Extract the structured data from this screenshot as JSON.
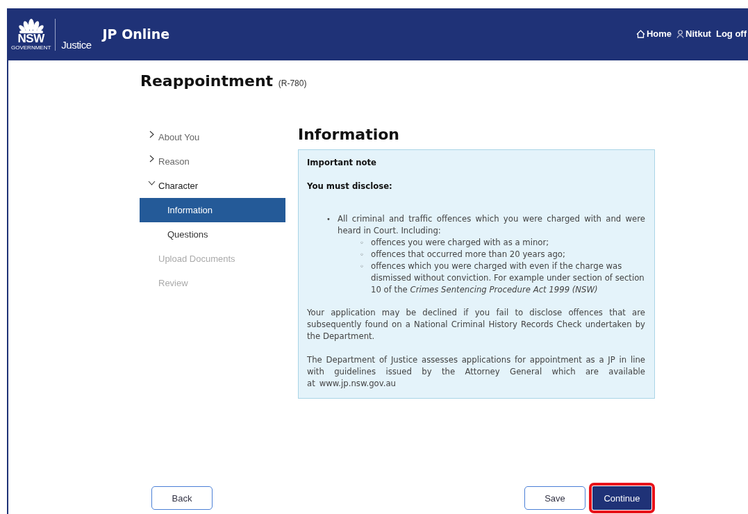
{
  "header": {
    "logo": {
      "mark": "NSW",
      "sub": "GOVERNMENT",
      "agency": "Justice"
    },
    "app_title": "JP Online",
    "links": [
      {
        "kind": "home",
        "label": "Home"
      },
      {
        "kind": "user",
        "label": "Nitkut"
      },
      {
        "kind": "plain",
        "label": "Log off"
      }
    ]
  },
  "page": {
    "title": "Reappointment",
    "code": "(R-780)"
  },
  "nav": [
    {
      "label": "About You",
      "kind": "section",
      "expanded": false,
      "disabled": false,
      "selected": false
    },
    {
      "label": "Reason",
      "kind": "section",
      "expanded": false,
      "disabled": false,
      "selected": false
    },
    {
      "label": "Character",
      "kind": "section",
      "expanded": true,
      "disabled": false,
      "selected": false,
      "children": [
        {
          "label": "Information",
          "disabled": false,
          "selected": true
        },
        {
          "label": "Questions",
          "disabled": false,
          "selected": false
        }
      ]
    },
    {
      "label": "Upload Documents",
      "kind": "plain",
      "disabled": true,
      "selected": false
    },
    {
      "label": "Review",
      "kind": "plain",
      "disabled": true,
      "selected": false
    }
  ],
  "content": {
    "heading": "Information",
    "note": {
      "title": "Important note",
      "lead": "You must disclose:",
      "bullets": [
        {
          "marker": "•",
          "text": "All criminal and traffic offences which you were charged with and were heard in Court. Including:",
          "children": [
            {
              "marker": "◦",
              "text": "offences you were charged with as a minor;"
            },
            {
              "marker": "◦",
              "text": "offences that occurred more than 20 years ago;"
            },
            {
              "marker": "◦",
              "text": "offences which you were charged with even if the charge was dismissed without conviction. For example under section of section 10 of the *Crimes Sentencing Procedure Act 1999 (NSW)*"
            }
          ]
        }
      ],
      "paragraphs": [
        {
          "text": "Your application may be declined if you fail to disclose offences that are subsequently found on a National Criminal History Records Check undertaken by the Department."
        },
        {
          "text": "The Department of Justice assesses applications for appointment as a JP in line with guidelines issued by the Attorney General which are available at",
          "link": "www.jp.nsw.gov.au"
        }
      ]
    }
  },
  "buttons": [
    {
      "label": "Back",
      "kind": "secondary",
      "highlighted": false
    },
    {
      "label": "Save",
      "kind": "secondary",
      "highlighted": false
    },
    {
      "label": "Continue",
      "kind": "primary",
      "highlighted": true
    }
  ]
}
